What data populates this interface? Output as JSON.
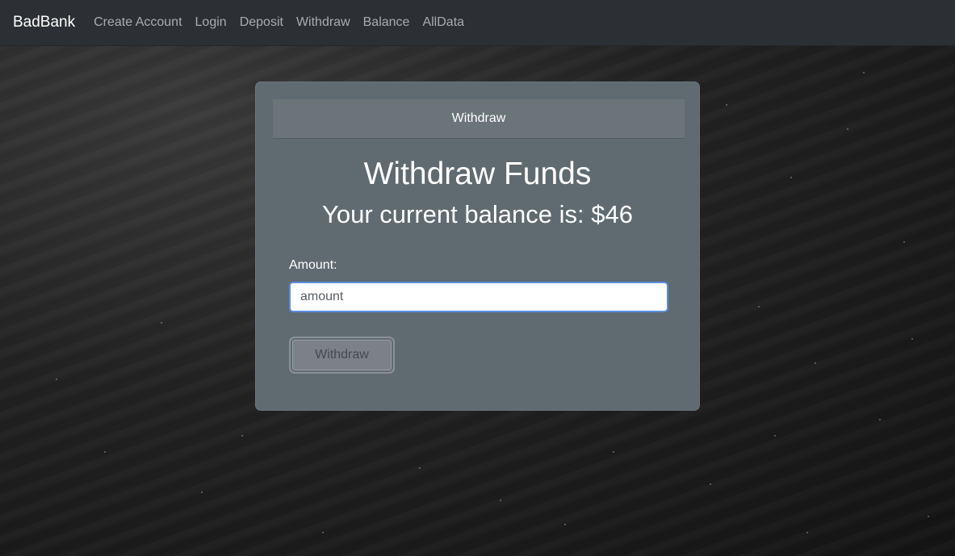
{
  "nav": {
    "brand": "BadBank",
    "links": [
      "Create Account",
      "Login",
      "Deposit",
      "Withdraw",
      "Balance",
      "AllData"
    ]
  },
  "card": {
    "header": "Withdraw",
    "title": "Withdraw Funds",
    "balance_text": "Your current balance is: $46",
    "amount_label": "Amount:",
    "amount_placeholder": "amount",
    "amount_value": "",
    "submit_label": "Withdraw"
  }
}
